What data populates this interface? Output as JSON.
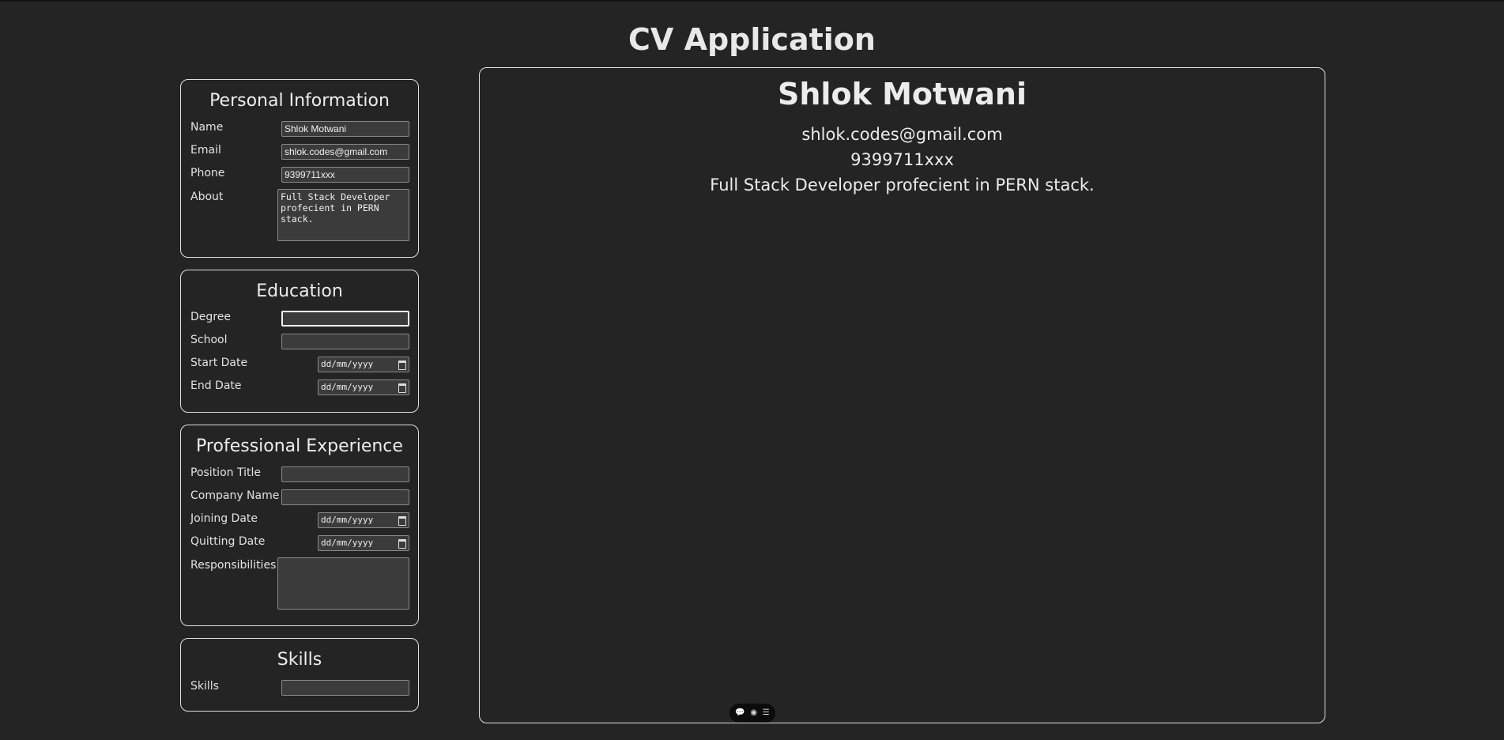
{
  "app": {
    "title": "CV Application"
  },
  "personal": {
    "heading": "Personal Information",
    "name_label": "Name",
    "name_value": "Shlok Motwani",
    "email_label": "Email",
    "email_value": "shlok.codes@gmail.com",
    "phone_label": "Phone",
    "phone_value": "9399711xxx",
    "about_label": "About",
    "about_value": "Full Stack Developer profecient in PERN stack."
  },
  "education": {
    "heading": "Education",
    "degree_label": "Degree",
    "degree_value": "",
    "school_label": "School",
    "school_value": "",
    "start_label": "Start Date",
    "start_placeholder": "dd/mm/yyyy",
    "end_label": "End Date",
    "end_placeholder": "dd/mm/yyyy"
  },
  "experience": {
    "heading": "Professional Experience",
    "position_label": "Position Title",
    "position_value": "",
    "company_label": "Company Name",
    "company_value": "",
    "joining_label": "Joining Date",
    "joining_placeholder": "dd/mm/yyyy",
    "quitting_label": "Quitting Date",
    "quitting_placeholder": "dd/mm/yyyy",
    "responsibilities_label": "Responsibilities",
    "responsibilities_value": ""
  },
  "skills": {
    "heading": "Skills",
    "skills_label": "Skills",
    "skills_value": ""
  },
  "preview": {
    "name": "Shlok Motwani",
    "email": "shlok.codes@gmail.com",
    "phone": "9399711xxx",
    "about": "Full Stack Developer profecient in PERN stack."
  },
  "toolbar": {
    "icons": [
      "comment-icon",
      "eye-icon",
      "settings-icon"
    ],
    "glyphs": [
      "💬",
      "◉",
      "☰"
    ]
  },
  "colors": {
    "background": "#242424",
    "border": "#e0e0e0",
    "input_bg": "#3b3b3b"
  }
}
